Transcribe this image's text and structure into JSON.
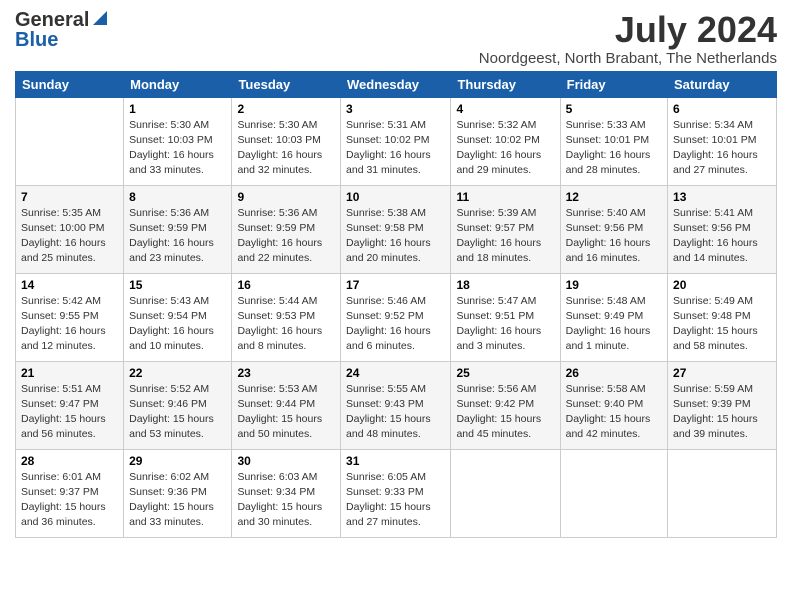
{
  "logo": {
    "general": "General",
    "blue": "Blue"
  },
  "title": {
    "month_year": "July 2024",
    "location": "Noordgeest, North Brabant, The Netherlands"
  },
  "days_of_week": [
    "Sunday",
    "Monday",
    "Tuesday",
    "Wednesday",
    "Thursday",
    "Friday",
    "Saturday"
  ],
  "weeks": [
    [
      {
        "day": "",
        "info": ""
      },
      {
        "day": "1",
        "info": "Sunrise: 5:30 AM\nSunset: 10:03 PM\nDaylight: 16 hours\nand 33 minutes."
      },
      {
        "day": "2",
        "info": "Sunrise: 5:30 AM\nSunset: 10:03 PM\nDaylight: 16 hours\nand 32 minutes."
      },
      {
        "day": "3",
        "info": "Sunrise: 5:31 AM\nSunset: 10:02 PM\nDaylight: 16 hours\nand 31 minutes."
      },
      {
        "day": "4",
        "info": "Sunrise: 5:32 AM\nSunset: 10:02 PM\nDaylight: 16 hours\nand 29 minutes."
      },
      {
        "day": "5",
        "info": "Sunrise: 5:33 AM\nSunset: 10:01 PM\nDaylight: 16 hours\nand 28 minutes."
      },
      {
        "day": "6",
        "info": "Sunrise: 5:34 AM\nSunset: 10:01 PM\nDaylight: 16 hours\nand 27 minutes."
      }
    ],
    [
      {
        "day": "7",
        "info": "Sunrise: 5:35 AM\nSunset: 10:00 PM\nDaylight: 16 hours\nand 25 minutes."
      },
      {
        "day": "8",
        "info": "Sunrise: 5:36 AM\nSunset: 9:59 PM\nDaylight: 16 hours\nand 23 minutes."
      },
      {
        "day": "9",
        "info": "Sunrise: 5:36 AM\nSunset: 9:59 PM\nDaylight: 16 hours\nand 22 minutes."
      },
      {
        "day": "10",
        "info": "Sunrise: 5:38 AM\nSunset: 9:58 PM\nDaylight: 16 hours\nand 20 minutes."
      },
      {
        "day": "11",
        "info": "Sunrise: 5:39 AM\nSunset: 9:57 PM\nDaylight: 16 hours\nand 18 minutes."
      },
      {
        "day": "12",
        "info": "Sunrise: 5:40 AM\nSunset: 9:56 PM\nDaylight: 16 hours\nand 16 minutes."
      },
      {
        "day": "13",
        "info": "Sunrise: 5:41 AM\nSunset: 9:56 PM\nDaylight: 16 hours\nand 14 minutes."
      }
    ],
    [
      {
        "day": "14",
        "info": "Sunrise: 5:42 AM\nSunset: 9:55 PM\nDaylight: 16 hours\nand 12 minutes."
      },
      {
        "day": "15",
        "info": "Sunrise: 5:43 AM\nSunset: 9:54 PM\nDaylight: 16 hours\nand 10 minutes."
      },
      {
        "day": "16",
        "info": "Sunrise: 5:44 AM\nSunset: 9:53 PM\nDaylight: 16 hours\nand 8 minutes."
      },
      {
        "day": "17",
        "info": "Sunrise: 5:46 AM\nSunset: 9:52 PM\nDaylight: 16 hours\nand 6 minutes."
      },
      {
        "day": "18",
        "info": "Sunrise: 5:47 AM\nSunset: 9:51 PM\nDaylight: 16 hours\nand 3 minutes."
      },
      {
        "day": "19",
        "info": "Sunrise: 5:48 AM\nSunset: 9:49 PM\nDaylight: 16 hours\nand 1 minute."
      },
      {
        "day": "20",
        "info": "Sunrise: 5:49 AM\nSunset: 9:48 PM\nDaylight: 15 hours\nand 58 minutes."
      }
    ],
    [
      {
        "day": "21",
        "info": "Sunrise: 5:51 AM\nSunset: 9:47 PM\nDaylight: 15 hours\nand 56 minutes."
      },
      {
        "day": "22",
        "info": "Sunrise: 5:52 AM\nSunset: 9:46 PM\nDaylight: 15 hours\nand 53 minutes."
      },
      {
        "day": "23",
        "info": "Sunrise: 5:53 AM\nSunset: 9:44 PM\nDaylight: 15 hours\nand 50 minutes."
      },
      {
        "day": "24",
        "info": "Sunrise: 5:55 AM\nSunset: 9:43 PM\nDaylight: 15 hours\nand 48 minutes."
      },
      {
        "day": "25",
        "info": "Sunrise: 5:56 AM\nSunset: 9:42 PM\nDaylight: 15 hours\nand 45 minutes."
      },
      {
        "day": "26",
        "info": "Sunrise: 5:58 AM\nSunset: 9:40 PM\nDaylight: 15 hours\nand 42 minutes."
      },
      {
        "day": "27",
        "info": "Sunrise: 5:59 AM\nSunset: 9:39 PM\nDaylight: 15 hours\nand 39 minutes."
      }
    ],
    [
      {
        "day": "28",
        "info": "Sunrise: 6:01 AM\nSunset: 9:37 PM\nDaylight: 15 hours\nand 36 minutes."
      },
      {
        "day": "29",
        "info": "Sunrise: 6:02 AM\nSunset: 9:36 PM\nDaylight: 15 hours\nand 33 minutes."
      },
      {
        "day": "30",
        "info": "Sunrise: 6:03 AM\nSunset: 9:34 PM\nDaylight: 15 hours\nand 30 minutes."
      },
      {
        "day": "31",
        "info": "Sunrise: 6:05 AM\nSunset: 9:33 PM\nDaylight: 15 hours\nand 27 minutes."
      },
      {
        "day": "",
        "info": ""
      },
      {
        "day": "",
        "info": ""
      },
      {
        "day": "",
        "info": ""
      }
    ]
  ]
}
